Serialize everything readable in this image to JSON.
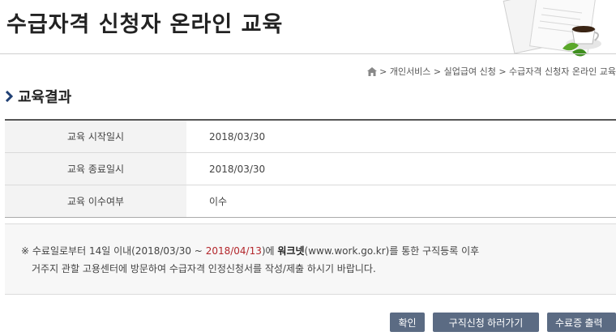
{
  "header": {
    "title": "수급자격 신청자 온라인 교육"
  },
  "breadcrumb": {
    "text": "> 개인서비스 > 실업급여 신청 > 수급자격 신청자 온라인 교육"
  },
  "section": {
    "title": "교육결과"
  },
  "results": [
    {
      "label": "교육 시작일시",
      "value": "2018/03/30"
    },
    {
      "label": "교육 종료일시",
      "value": "2018/03/30"
    },
    {
      "label": "교육 이수여부",
      "value": "이수"
    }
  ],
  "notice": {
    "mark": "※",
    "line1_a": "수료일로부터 14일 이내(2018/03/30 ~ ",
    "line1_date": "2018/04/13",
    "line1_b": ")에 ",
    "line1_site": "워크넷",
    "line1_c": "(www.work.go.kr)를 통한 구직등록 이후",
    "line2": "거주지 관할 고용센터에 방문하여 수급자격 인정신청서를 작성/제출 하시기 바랍니다."
  },
  "buttons": {
    "confirm": "확인",
    "job_search": "구직신청 하러가기",
    "certificate": "수료증 출력"
  }
}
